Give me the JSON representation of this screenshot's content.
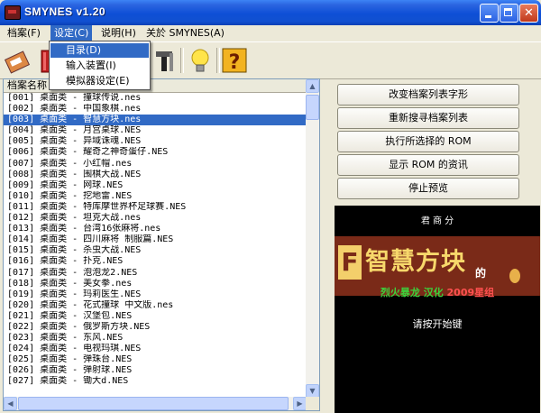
{
  "window": {
    "title": "SMYNES v1.20"
  },
  "menu": [
    {
      "label": "档案(F)"
    },
    {
      "label": "设定(C)"
    },
    {
      "label": "说明(H)"
    },
    {
      "label": "关於 SMYNES(A)"
    }
  ],
  "settings_menu": [
    {
      "label": "目录(D)"
    },
    {
      "label": "输入装置(I)"
    },
    {
      "label": "模拟器设定(E)"
    }
  ],
  "toolbar_icons": [
    "rom-icon",
    "book-icon",
    "tools-icon",
    "lightbulb-icon",
    "help-icon"
  ],
  "list": {
    "header": "档案名称",
    "selected": "[003]",
    "rows": [
      "[001] 桌面类 - 撞球传说.nes",
      "[002] 桌面类 - 中国象棋.nes",
      "[003] 桌面类 - 智慧方块.nes",
      "[004] 桌面类 - 月宫桌球.NES",
      "[005] 桌面类 - 异域诛魂.NES",
      "[006] 桌面类 - 耀奇之神奇蛋仔.NES",
      "[007] 桌面类 - 小红帽.nes",
      "[008] 桌面类 - 围棋大战.NES",
      "[009] 桌面类 - 网球.NES",
      "[010] 桌面类 - 挖地雷.NES",
      "[011] 桌面类 - 特库摩世界杯足球赛.NES",
      "[012] 桌面类 - 坦克大战.nes",
      "[013] 桌面类 - 台湾16张麻将.nes",
      "[014] 桌面类 - 四川麻将 制服篇.NES",
      "[015] 桌面类 - 杀虫大战.NES",
      "[016] 桌面类 - 扑克.NES",
      "[017] 桌面类 - 泡泡龙2.NES",
      "[018] 桌面类 - 美女拳.nes",
      "[019] 桌面类 - 玛莉医生.NES",
      "[020] 桌面类 - 花式撞球 中文版.nes",
      "[021] 桌面类 - 汉堡包.NES",
      "[022] 桌面类 - 俄罗斯方块.NES",
      "[023] 桌面类 - 东风.NES",
      "[024] 桌面类 - 电视玛琪.NES",
      "[025] 桌面类 - 弹珠台.NES",
      "[026] 桌面类 - 弹射球.NES",
      "[027] 桌面类 - 锄大d.NES"
    ]
  },
  "actions": [
    {
      "label": "改变档案列表字形"
    },
    {
      "label": "重新搜寻档案列表"
    },
    {
      "label": "执行所选择的 ROM"
    },
    {
      "label": "显示 ROM 的资讯"
    },
    {
      "label": "停止预览"
    }
  ],
  "preview": {
    "top_text": "君 商 分",
    "logo_f": "F",
    "logo_title": "智慧方块",
    "logo_suffix": "的",
    "credit_a": "烈火暴龙",
    "credit_b": "汉化",
    "credit_year": "2009",
    "credit_group": "星组",
    "prompt": "请按开始键"
  },
  "colors": {
    "selection": "#316ac5",
    "titlebar": "#0e4fd6"
  }
}
